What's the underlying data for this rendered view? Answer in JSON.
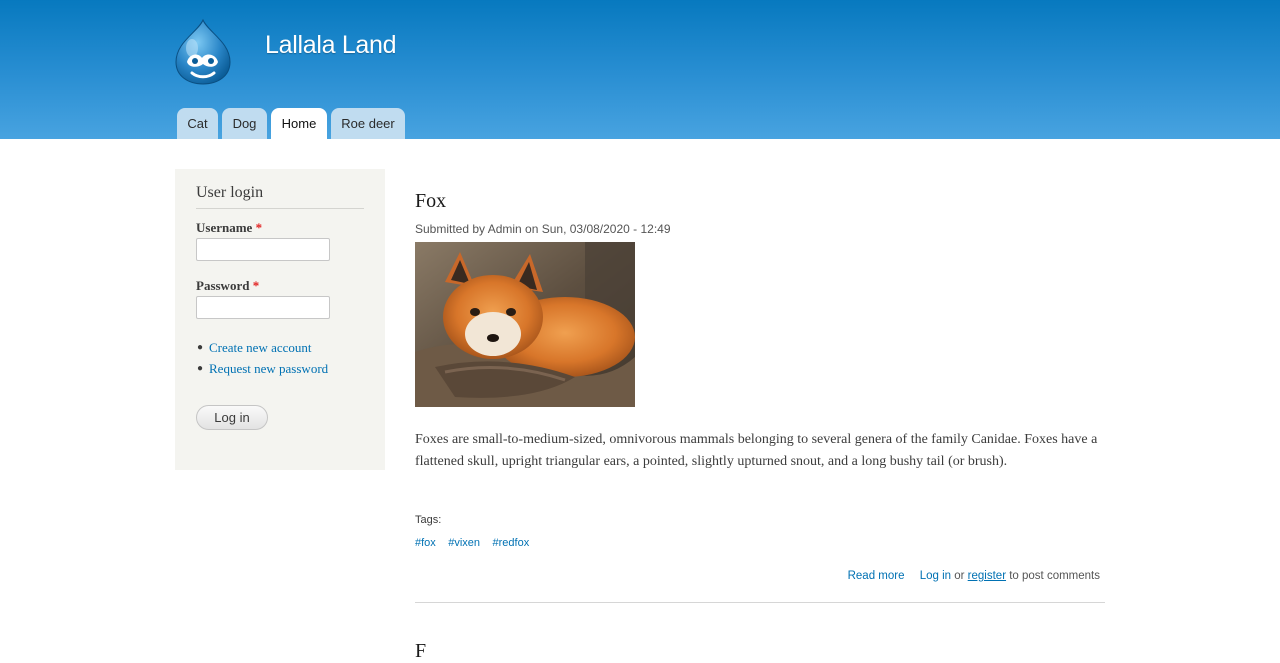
{
  "site": {
    "name": "Lallala Land",
    "logo_icon": "drupal-drop-icon",
    "header_color_top": "#0779bf",
    "header_color_bottom": "#48a3e0"
  },
  "nav": {
    "tabs": [
      {
        "label": "Cat",
        "active": false
      },
      {
        "label": "Dog",
        "active": false
      },
      {
        "label": "Home",
        "active": true
      },
      {
        "label": "Roe deer",
        "active": false
      }
    ]
  },
  "login_block": {
    "title": "User login",
    "username_label": "Username",
    "password_label": "Password",
    "required_mark": "*",
    "username_value": "",
    "password_value": "",
    "links": [
      "Create new account",
      "Request new password"
    ],
    "submit_label": "Log in"
  },
  "article": {
    "title": "Fox",
    "submitted": "Submitted by Admin on Sun, 03/08/2020 - 12:49",
    "image_description": "red fox lying down",
    "body": "Foxes are small-to-medium-sized, omnivorous mammals belonging to several genera of the family Canidae. Foxes have a flattened skull, upright triangular ears, a pointed, slightly upturned snout, and a long bushy tail (or brush).",
    "tags_label": "Tags:",
    "tags": [
      "#fox",
      "#vixen",
      "#redfox"
    ],
    "read_more": "Read more",
    "login_link": "Log in",
    "or_text": "or",
    "register_link": "register",
    "comment_suffix": "to post comments"
  },
  "next_article": {
    "title": "F"
  },
  "colors": {
    "link": "#0071b3",
    "required": "#e11b1b",
    "sidebar_bg": "#f4f4f0",
    "tab_bg": "#c0dcf0"
  }
}
